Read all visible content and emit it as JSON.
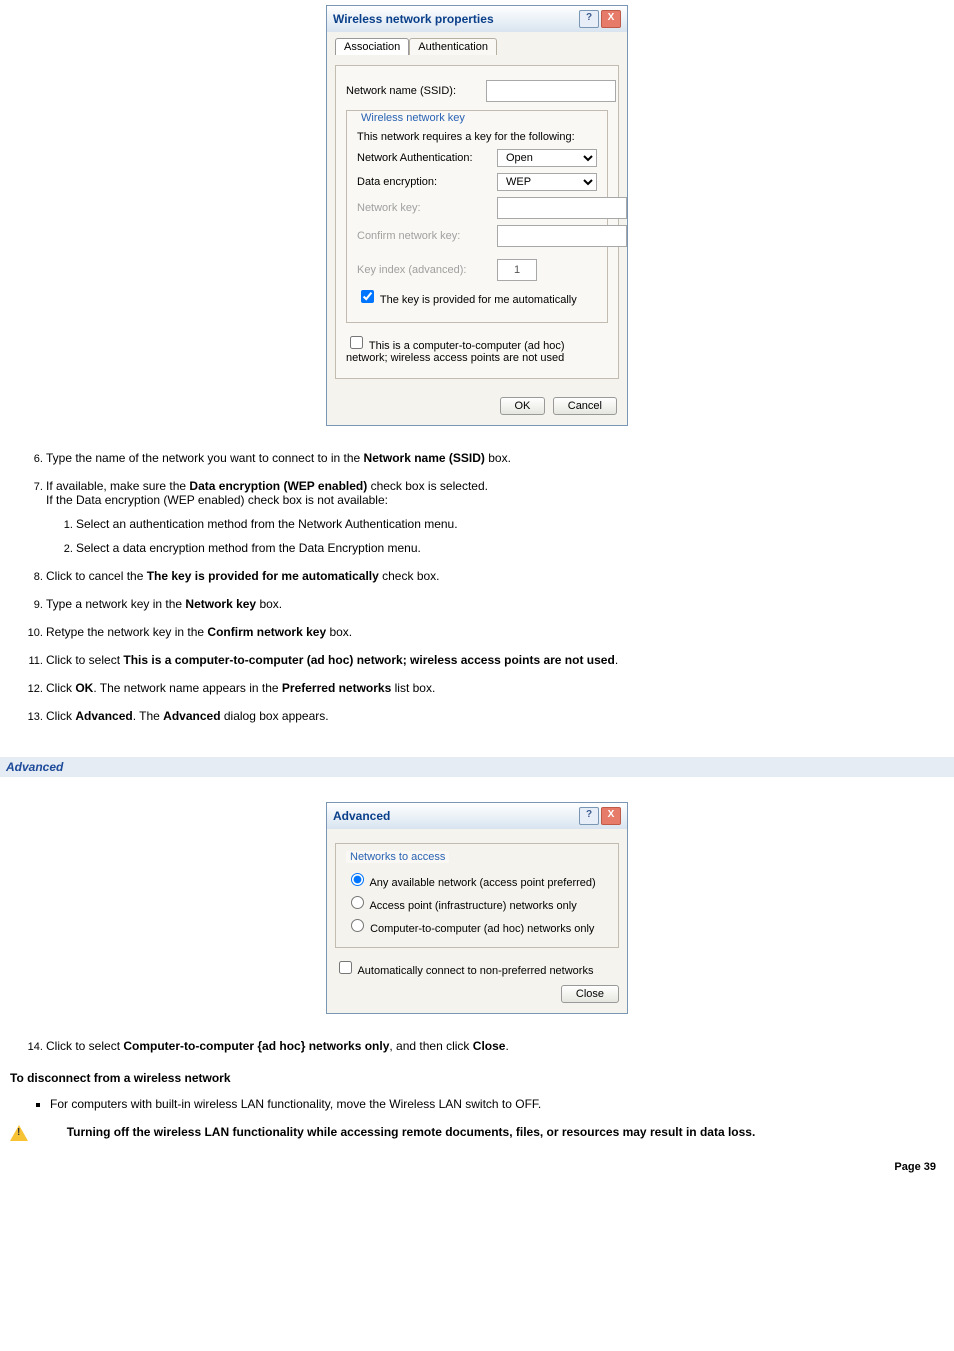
{
  "wireless_dialog": {
    "title": "Wireless network properties",
    "help_btn": "?",
    "close_btn": "X",
    "tabs": {
      "association": "Association",
      "authentication": "Authentication"
    },
    "ssid_label": "Network name (SSID):",
    "section_title": "Wireless network key",
    "requires_text": "This network requires a key for the following:",
    "auth_label": "Network Authentication:",
    "auth_value": "Open",
    "enc_label": "Data encryption:",
    "enc_value": "WEP",
    "key_label": "Network key:",
    "confirm_label": "Confirm network key:",
    "index_label": "Key index (advanced):",
    "index_value": "1",
    "auto_key_label": "The key is provided for me automatically",
    "adhoc_label": "This is a computer-to-computer (ad hoc) network; wireless access points are not used",
    "ok": "OK",
    "cancel": "Cancel"
  },
  "steps": {
    "s6": {
      "pre": "Type the name of the network you want to connect to in the ",
      "b": "Network name (SSID)",
      "post": " box."
    },
    "s7": {
      "line1_pre": "If available, make sure the ",
      "line1_b": "Data encryption (WEP enabled)",
      "line1_post": " check box is selected.",
      "line2": "If the Data encryption (WEP enabled) check box is not available:",
      "sub1": "Select an authentication method from the Network Authentication menu.",
      "sub2": "Select a data encryption method from the Data Encryption menu."
    },
    "s8": {
      "pre": "Click to cancel the ",
      "b": "The key is provided for me automatically",
      "post": " check box."
    },
    "s9": {
      "pre": "Type a network key in the ",
      "b": "Network key",
      "post": " box."
    },
    "s10": {
      "pre": "Retype the network key in the ",
      "b": "Confirm network key",
      "post": " box."
    },
    "s11": {
      "pre": "Click to select ",
      "b": "This is a computer-to-computer (ad hoc) network; wireless access points are not used",
      "post": "."
    },
    "s12": {
      "pre": "Click ",
      "b1": "OK",
      "mid": ". The network name appears in the ",
      "b2": "Preferred networks",
      "post": " list box."
    },
    "s13": {
      "pre": "Click ",
      "b1": "Advanced",
      "mid": ". The ",
      "b2": "Advanced",
      "post": " dialog box appears."
    },
    "s14": {
      "pre": "Click to select ",
      "b1": "Computer-to-computer {ad hoc} networks only",
      "mid": ", and then click ",
      "b2": "Close",
      "post": "."
    }
  },
  "section": {
    "advanced": "Advanced"
  },
  "advanced_dialog": {
    "title": "Advanced",
    "help_btn": "?",
    "close_btn": "X",
    "fieldset_title": "Networks to access",
    "r1": "Any available network (access point preferred)",
    "r2": "Access point (infrastructure) networks only",
    "r3": "Computer-to-computer (ad hoc) networks only",
    "auto": "Automatically connect to non-preferred networks",
    "close": "Close"
  },
  "disconnect": {
    "heading": "To disconnect from a wireless network",
    "bullet": "For computers with built-in wireless LAN functionality, move the Wireless LAN switch to OFF."
  },
  "warning": "Turning off the wireless LAN functionality while accessing remote documents, files, or resources may result in data loss.",
  "page_number": "Page 39"
}
